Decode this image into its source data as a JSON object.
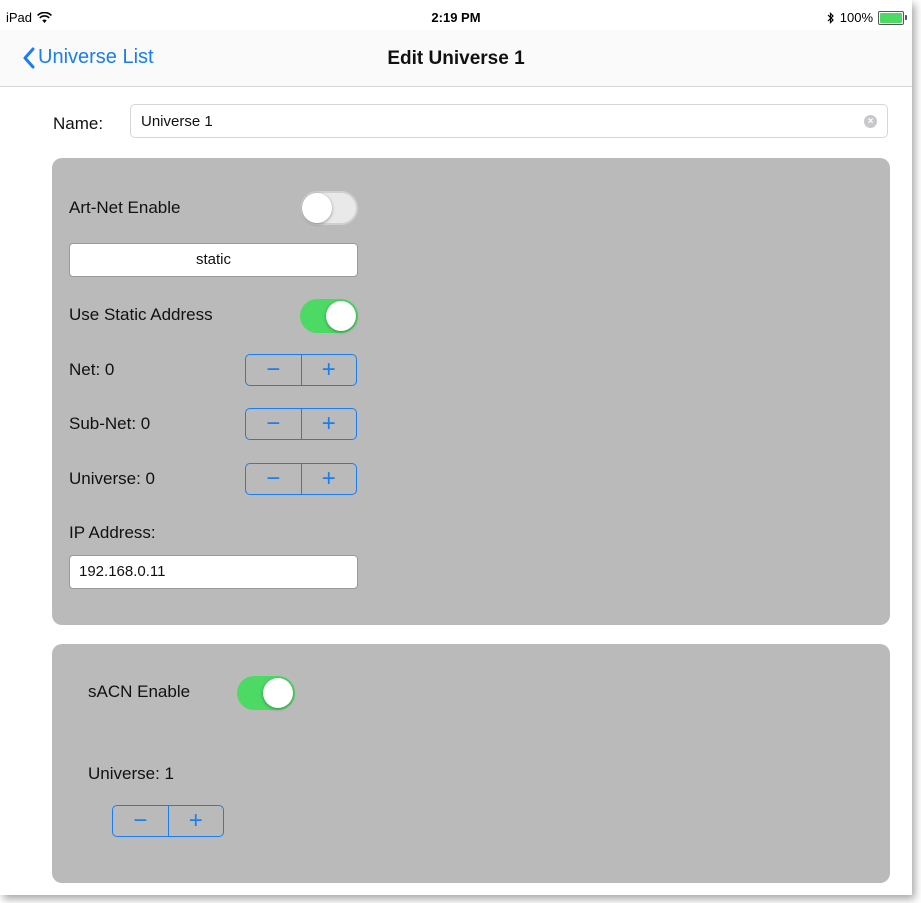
{
  "status_bar": {
    "device": "iPad",
    "time": "2:19 PM",
    "battery_percent": "100%",
    "battery_level": 1.0
  },
  "nav": {
    "back_label": "Universe List",
    "title": "Edit Universe 1"
  },
  "name": {
    "label": "Name:",
    "value": "Universe 1"
  },
  "artnet": {
    "enable_label": "Art-Net Enable",
    "enable_on": false,
    "mode_value": "static",
    "static_label": "Use Static Address",
    "static_on": true,
    "net_label": "Net: 0",
    "subnet_label": "Sub-Net: 0",
    "universe_label": "Universe: 0",
    "ip_label": "IP Address:",
    "ip_value": "192.168.0.11"
  },
  "sacn": {
    "enable_label": "sACN Enable",
    "enable_on": true,
    "universe_label": "Universe: 1"
  },
  "stepper": {
    "minus": "−",
    "plus": "+"
  },
  "colors": {
    "accent": "#1a7df0",
    "switch_on": "#4cd964",
    "panel": "#bababa"
  }
}
